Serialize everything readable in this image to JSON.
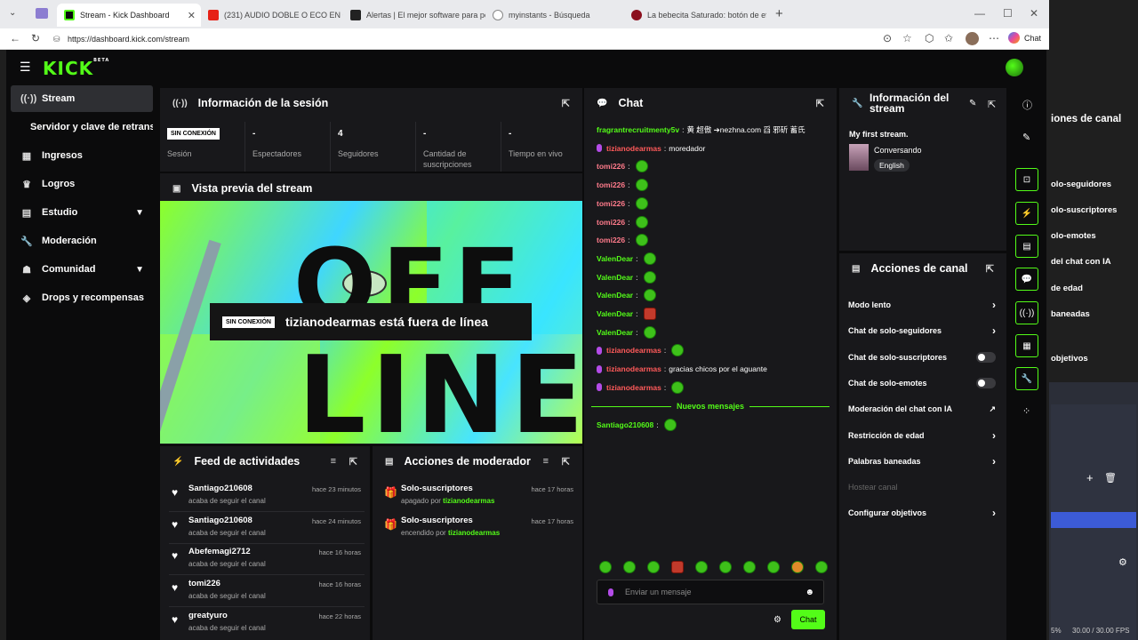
{
  "browser": {
    "tabs": [
      {
        "label": "Stream - Kick Dashboard",
        "active": true
      },
      {
        "label": "(231) AUDIO DOBLE O ECO EN OB"
      },
      {
        "label": "Alertas | El mejor software para pe"
      },
      {
        "label": "myinstants - Búsqueda"
      },
      {
        "label": "La bebecita Saturado: botón de efe"
      }
    ],
    "url": "https://dashboard.kick.com/stream",
    "chat_button": "Chat"
  },
  "app": {
    "logo": "KICK",
    "logo_badge": "BETA",
    "sidebar": [
      {
        "label": "Stream",
        "icon": "broadcast-icon",
        "active": true
      },
      {
        "label": "Servidor y clave de retransmisión",
        "icon": ""
      },
      {
        "label": "Ingresos",
        "icon": "grid-icon"
      },
      {
        "label": "Logros",
        "icon": "trophy-icon"
      },
      {
        "label": "Estudio",
        "icon": "layout-icon",
        "chevron": true
      },
      {
        "label": "Moderación",
        "icon": "wrench-icon"
      },
      {
        "label": "Comunidad",
        "icon": "users-icon",
        "chevron": true
      },
      {
        "label": "Drops y recompensas",
        "icon": "drops-icon"
      }
    ],
    "session": {
      "title": "Información de la sesión",
      "status_badge": "SIN CONEXIÓN",
      "stats": [
        {
          "value": "",
          "label": "Sesión"
        },
        {
          "value": "-",
          "label": "Espectadores"
        },
        {
          "value": "4",
          "label": "Seguidores"
        },
        {
          "value": "-",
          "label": "Cantidad de suscripciones"
        },
        {
          "value": "-",
          "label": "Tiempo en vivo"
        }
      ]
    },
    "preview": {
      "title": "Vista previa del stream",
      "art_text_1": "OFF",
      "art_text_2": "LINE",
      "offline_badge": "SIN CONEXIÓN",
      "offline_text": "tizianodearmas está fuera de línea"
    },
    "activity": {
      "title": "Feed de actividades",
      "items": [
        {
          "user": "Santiago210608",
          "sub": "acaba de seguir el canal",
          "time": "hace 23 minutos"
        },
        {
          "user": "Santiago210608",
          "sub": "acaba de seguir el canal",
          "time": "hace 24 minutos"
        },
        {
          "user": "Abefemagi2712",
          "sub": "acaba de seguir el canal",
          "time": "hace 16 horas"
        },
        {
          "user": "tomi226",
          "sub": "acaba de seguir el canal",
          "time": "hace 16 horas"
        },
        {
          "user": "greatyuro",
          "sub": "acaba de seguir el canal",
          "time": "hace 22 horas"
        }
      ]
    },
    "mod_actions": {
      "title": "Acciones de moderador",
      "items": [
        {
          "action": "Solo-suscriptores",
          "by_prefix": "apagado por",
          "by": "tizianodearmas",
          "time": "hace 17 horas"
        },
        {
          "action": "Solo-suscriptores",
          "by_prefix": "encendido por",
          "by": "tizianodearmas",
          "time": "hace 17 horas"
        }
      ]
    },
    "chat": {
      "title": "Chat",
      "messages": [
        {
          "user": "fragrantrecruitmenty5v",
          "color": "#53fc18",
          "text": "黄 超傲 ➔nezhna.com 舀 邪斫 蓄氏",
          "mic": false,
          "emotes": 0
        },
        {
          "user": "tizianodearmas",
          "color": "#ff5a5a",
          "text": "moredador",
          "mic": true,
          "emotes": 0
        },
        {
          "user": "tomi226",
          "color": "#ff7b8b",
          "text": "",
          "mic": false,
          "emotes": 1
        },
        {
          "user": "tomi226",
          "color": "#ff7b8b",
          "text": "",
          "mic": false,
          "emotes": 1
        },
        {
          "user": "tomi226",
          "color": "#ff7b8b",
          "text": "",
          "mic": false,
          "emotes": 1
        },
        {
          "user": "tomi226",
          "color": "#ff7b8b",
          "text": "",
          "mic": false,
          "emotes": 1
        },
        {
          "user": "tomi226",
          "color": "#ff7b8b",
          "text": "",
          "mic": false,
          "emotes": 1
        },
        {
          "user": "ValenDear",
          "color": "#53fc18",
          "text": "",
          "mic": false,
          "emotes": 1
        },
        {
          "user": "ValenDear",
          "color": "#53fc18",
          "text": "",
          "mic": false,
          "emotes": 1
        },
        {
          "user": "ValenDear",
          "color": "#53fc18",
          "text": "",
          "mic": false,
          "emotes": 1
        },
        {
          "user": "ValenDear",
          "color": "#53fc18",
          "text": "",
          "mic": false,
          "emotes": 1,
          "red": true
        },
        {
          "user": "ValenDear",
          "color": "#53fc18",
          "text": "",
          "mic": false,
          "emotes": 1
        },
        {
          "user": "tizianodearmas",
          "color": "#ff5a5a",
          "text": "",
          "mic": true,
          "emotes": 1
        },
        {
          "user": "tizianodearmas",
          "color": "#ff5a5a",
          "text": "gracias chicos por el aguante",
          "mic": true,
          "emotes": 0
        },
        {
          "user": "tizianodearmas",
          "color": "#ff5a5a",
          "text": "",
          "mic": true,
          "emotes": 1
        }
      ],
      "new_messages": "Nuevos mensajes",
      "after": [
        {
          "user": "Santiago210608",
          "color": "#53fc18",
          "text": "",
          "mic": false,
          "emotes": 1
        }
      ],
      "input_placeholder": "Enviar un mensaje",
      "send_label": "Chat"
    },
    "stream_info": {
      "title": "Información del stream",
      "stream_title": "My first stream.",
      "category": "Conversando",
      "language": "English"
    },
    "channel_actions": {
      "title": "Acciones de canal",
      "items": [
        {
          "label": "Modo lento",
          "type": "arrow"
        },
        {
          "label": "Chat de solo-seguidores",
          "type": "arrow"
        },
        {
          "label": "Chat de solo-suscriptores",
          "type": "toggle"
        },
        {
          "label": "Chat de solo-emotes",
          "type": "toggle"
        },
        {
          "label": "Moderación del chat con IA",
          "type": "external"
        },
        {
          "label": "Restricción de edad",
          "type": "arrow"
        },
        {
          "label": "Palabras baneadas",
          "type": "arrow"
        },
        {
          "label": "Hostear canal",
          "type": "disabled"
        },
        {
          "label": "Configurar objetivos",
          "type": "arrow"
        }
      ]
    }
  },
  "obs_behind": {
    "lines": [
      "iones de canal",
      "olo-seguidores",
      "olo-suscriptores",
      "olo-emotes",
      "del chat con IA",
      "de edad",
      "baneadas",
      "objetivos"
    ],
    "status": "30.00 / 30.00 FPS",
    "percent": "5%"
  }
}
